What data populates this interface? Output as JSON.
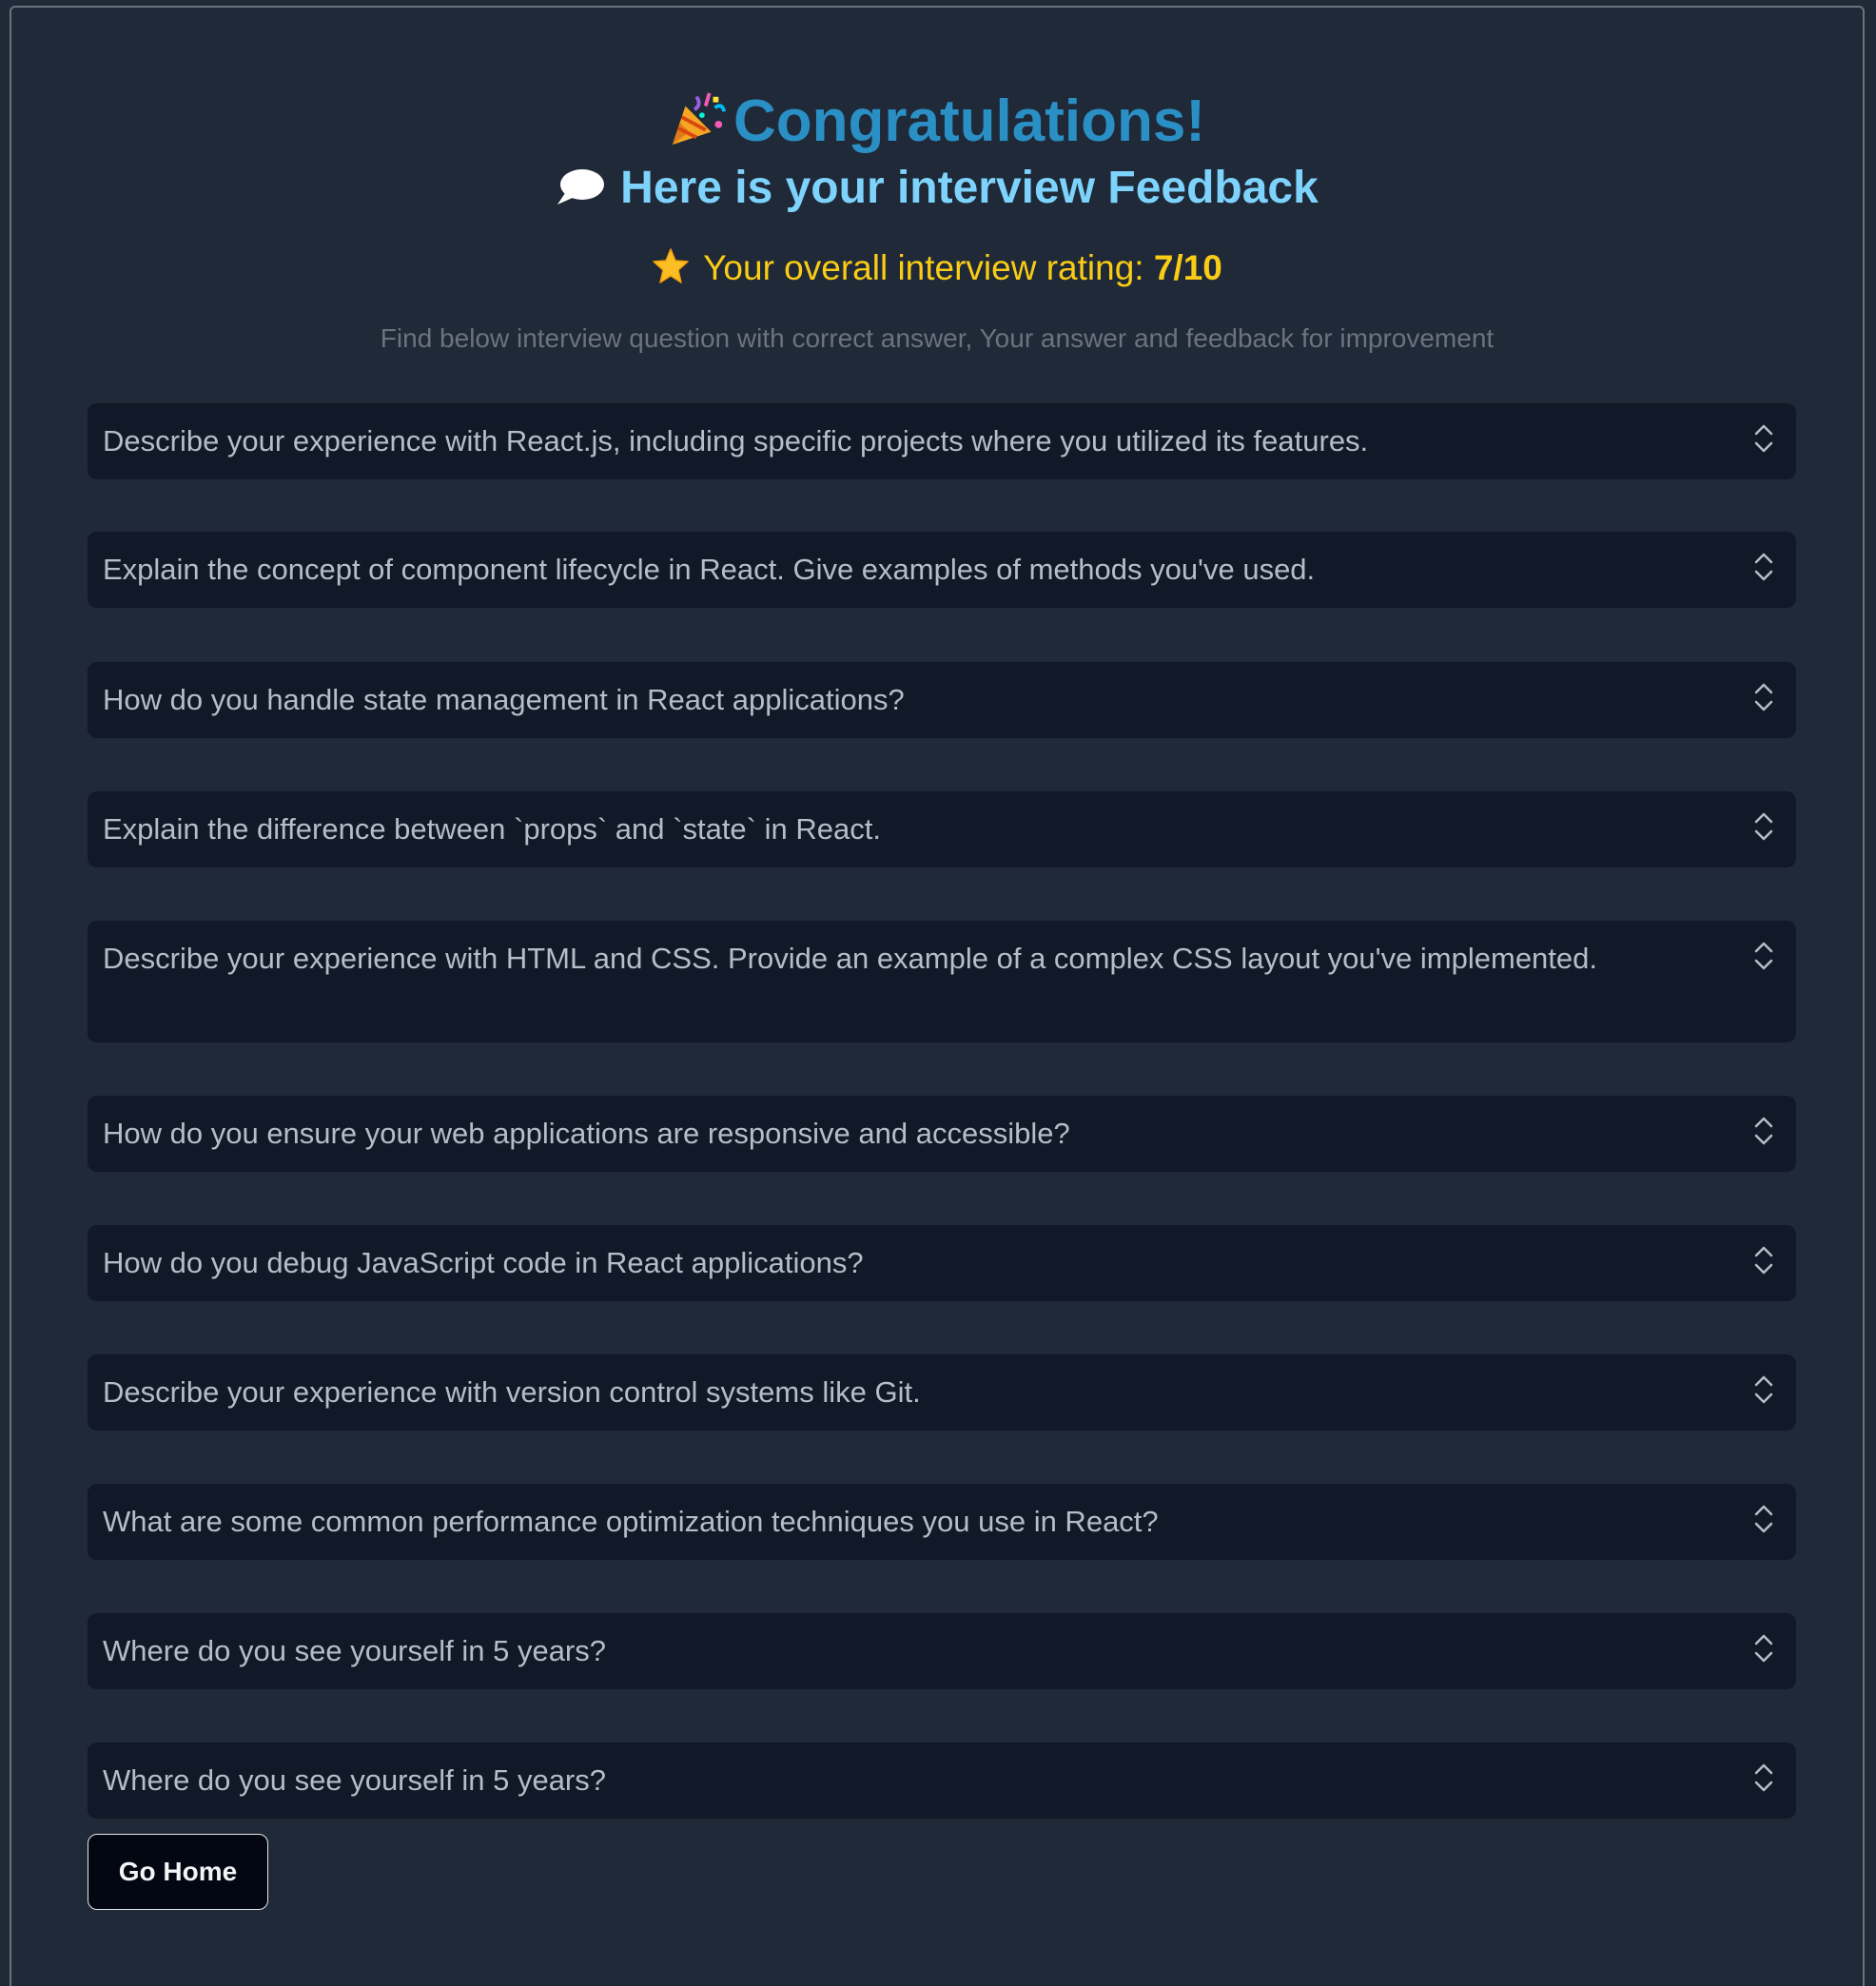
{
  "header": {
    "congrats_title": "Congratulations!",
    "feedback_title": "Here is your interview Feedback",
    "rating_label": "Your overall interview rating: ",
    "rating_value": "7/10",
    "hint": "Find below interview question with correct answer, Your answer and feedback for improvement"
  },
  "icons": {
    "title": "party-popper-icon",
    "subtitle": "speech-bubble-icon",
    "rating": "star-icon",
    "expand": "chevron-up-down-icon"
  },
  "questions": [
    "Describe your experience with React.js, including specific projects where you utilized its features.",
    "Explain the concept of component lifecycle in React. Give examples of methods you've used.",
    "How do you handle state management in React applications?",
    "Explain the difference between `props` and `state` in React.",
    "Describe your experience with HTML and CSS. Provide an example of a complex CSS layout you've implemented.",
    "How do you ensure your web applications are responsive and accessible?",
    "How do you debug JavaScript code in React applications?",
    "Describe your experience with version control systems like Git.",
    "What are some common performance optimization techniques you use in React?",
    "Where do you see yourself in 5 years?",
    "Where do you see yourself in 5 years?"
  ],
  "actions": {
    "home_label": "Go Home"
  },
  "colors": {
    "background": "#1f2937",
    "card": "#111827",
    "title": "#2a8fc4",
    "subtitle": "#7dd3fc",
    "rating": "#facc15"
  }
}
